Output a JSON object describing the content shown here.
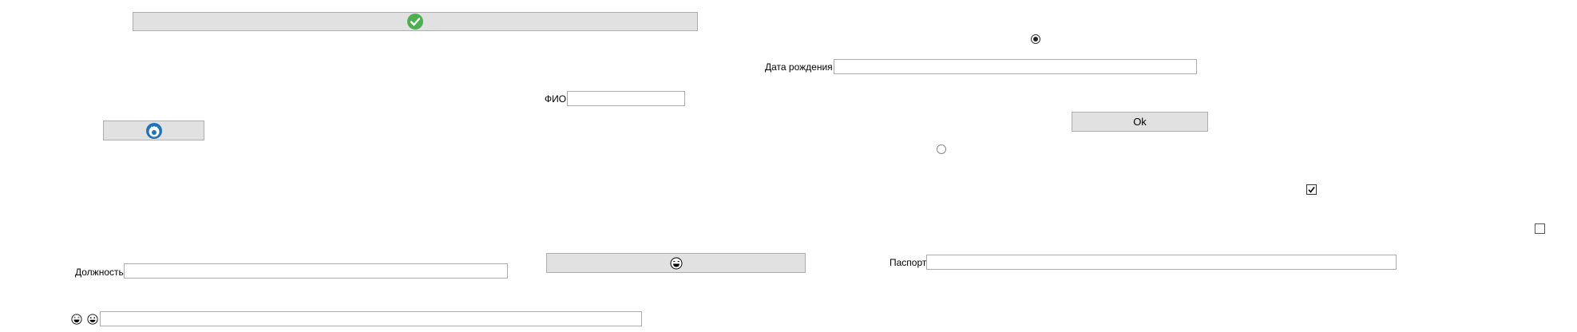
{
  "window": {
    "buttons": {
      "ok_label": "Ok",
      "check_icon": "check-circle-icon",
      "hands_icon": "raised-hands-icon",
      "face_icon": "laughing-face-icon"
    },
    "fields": {
      "birth_date_label": "Дата рождения",
      "birth_date_value": "",
      "fio_label": "ФИО",
      "fio_value": "",
      "position_label": "Должность",
      "position_value": "",
      "passport_label": "Паспорт",
      "passport_value": "",
      "emoji_field_value": ""
    },
    "radios": {
      "radio_top_checked": true,
      "radio_mid_checked": false
    },
    "checkboxes": {
      "checkbox_a_checked": true,
      "checkbox_b_checked": false
    },
    "colors": {
      "button_bg": "#e1e1e1",
      "check_green": "#4caf50",
      "hands_blue": "#1e73be"
    }
  }
}
